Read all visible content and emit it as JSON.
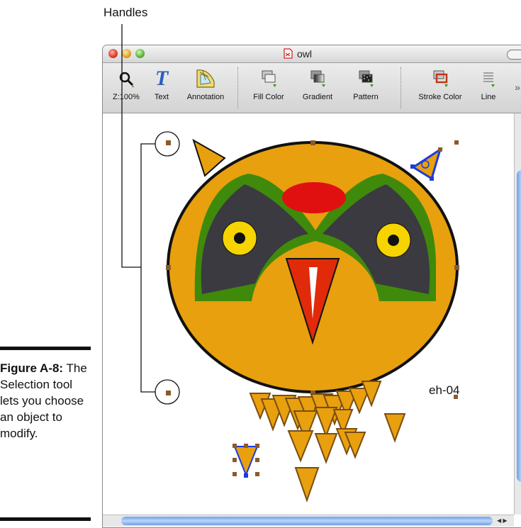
{
  "callout": {
    "label": "Handles"
  },
  "caption": {
    "figure": "Figure A-8:",
    "text": "The Selection tool lets you choose an object to modify."
  },
  "window": {
    "title": "owl",
    "doc_icon": "document-icon"
  },
  "toolbar": {
    "items": [
      {
        "label": "Z:100%",
        "icon": "zoom-icon"
      },
      {
        "label": "Text",
        "icon": "text-icon"
      },
      {
        "label": "Annotation",
        "icon": "annotation-icon"
      },
      {
        "label": "Fill Color",
        "icon": "fill-color-icon"
      },
      {
        "label": "Gradient",
        "icon": "gradient-icon"
      },
      {
        "label": "Pattern",
        "icon": "pattern-icon"
      },
      {
        "label": "Stroke Color",
        "icon": "stroke-color-icon"
      },
      {
        "label": "Line",
        "icon": "line-icon"
      }
    ],
    "overflow": "»"
  },
  "canvas": {
    "text_label": "eh-04"
  },
  "colors": {
    "owl_body": "#e8a00e",
    "eye_ring": "#3f8a0a",
    "eye_mask": "#3a3a40",
    "eye_iris": "#f5d400",
    "crest": "#e01010",
    "beak": "#e02a0a",
    "selection": "#1a3be0",
    "handle": "#8b5a2b"
  }
}
